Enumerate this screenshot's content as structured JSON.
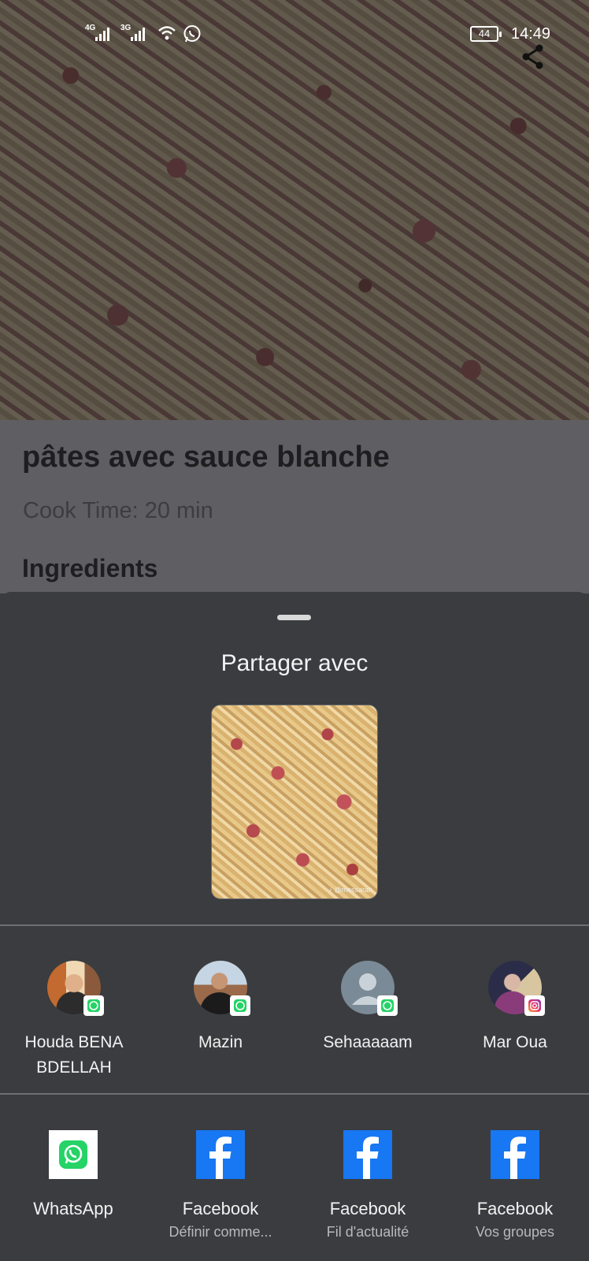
{
  "status_bar": {
    "sim1": "4G",
    "sim2": "3G",
    "battery": "44",
    "time": "14:49"
  },
  "recipe": {
    "title": "pâtes avec sauce blanche",
    "cook_time": "Cook Time: 20 min",
    "section": "Ingredients"
  },
  "share_sheet": {
    "title": "Partager avec",
    "preview_watermark": "♪ @messarah",
    "contacts": [
      {
        "name": "Houda BENA BDELLAH",
        "app_badge": "whatsapp-icon"
      },
      {
        "name": "Mazin",
        "app_badge": "whatsapp-icon"
      },
      {
        "name": "Sehaaaaam",
        "app_badge": "whatsapp-icon"
      },
      {
        "name": "Mar Oua",
        "app_badge": "instagram-icon"
      }
    ],
    "apps": [
      {
        "name": "WhatsApp",
        "sub": "",
        "icon": "whatsapp-icon"
      },
      {
        "name": "Facebook",
        "sub": "Définir comme...",
        "icon": "facebook-icon"
      },
      {
        "name": "Facebook",
        "sub": "Fil d'actualité",
        "icon": "facebook-icon"
      },
      {
        "name": "Facebook",
        "sub": "Vos groupes",
        "icon": "facebook-icon"
      }
    ]
  },
  "colors": {
    "sheet_bg": "#3a3c3f",
    "whatsapp": "#25d366",
    "facebook": "#1877f2"
  }
}
